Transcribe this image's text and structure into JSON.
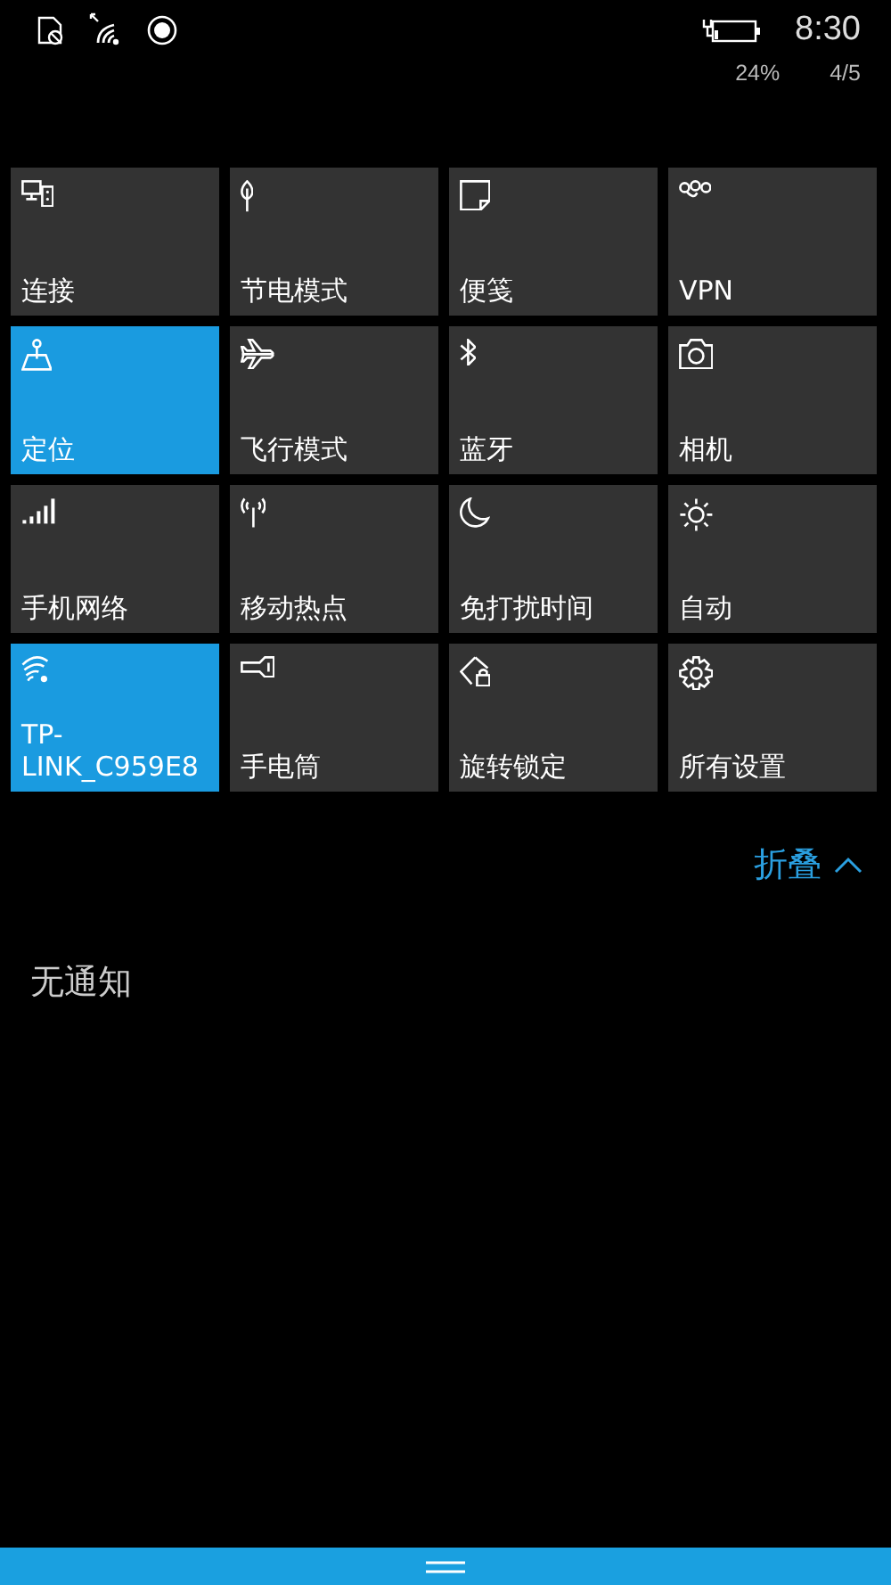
{
  "status_bar": {
    "time": "8:30",
    "battery_percent": "24%",
    "page": "4/5"
  },
  "tiles": [
    {
      "label": "连接",
      "on": false
    },
    {
      "label": "节电模式",
      "on": false
    },
    {
      "label": "便笺",
      "on": false
    },
    {
      "label": "VPN",
      "on": false
    },
    {
      "label": "定位",
      "on": true
    },
    {
      "label": "飞行模式",
      "on": false
    },
    {
      "label": "蓝牙",
      "on": false
    },
    {
      "label": "相机",
      "on": false
    },
    {
      "label": "手机网络",
      "on": false
    },
    {
      "label": "移动热点",
      "on": false
    },
    {
      "label": "免打扰时间",
      "on": false
    },
    {
      "label": "自动",
      "on": false
    },
    {
      "label": "TP-LINK_C959E8",
      "on": true
    },
    {
      "label": "手电筒",
      "on": false
    },
    {
      "label": "旋转锁定",
      "on": false
    },
    {
      "label": "所有设置",
      "on": false
    }
  ],
  "collapse_button": {
    "label": "折叠"
  },
  "notifications": {
    "empty_text": "无通知"
  }
}
